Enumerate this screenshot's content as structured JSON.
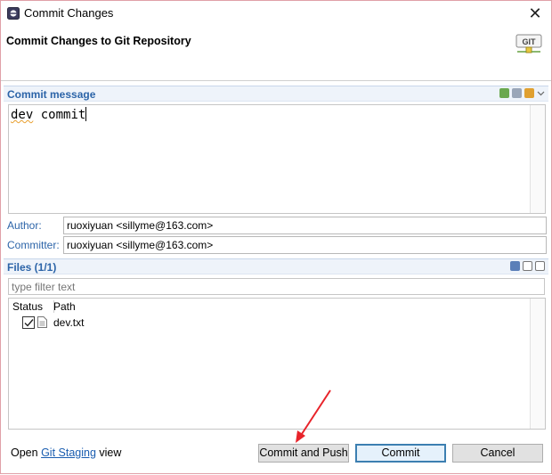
{
  "window": {
    "title": "Commit Changes",
    "close_glyph": "✕"
  },
  "header": {
    "title": "Commit Changes to Git Repository",
    "logo_text": "GIT"
  },
  "commit_message": {
    "section_title": "Commit message",
    "text_word1": "dev",
    "text_word2": "commit"
  },
  "author": {
    "label": "Author:",
    "value": "ruoxiyuan <sillyme@163.com>"
  },
  "committer": {
    "label": "Committer:",
    "value": "ruoxiyuan <sillyme@163.com>"
  },
  "files": {
    "section_title": "Files (1/1)",
    "filter_placeholder": "type filter text",
    "columns": [
      "Status",
      "Path"
    ],
    "rows": [
      {
        "path": "dev.txt",
        "checked": true
      }
    ]
  },
  "footer": {
    "open_text": "Open",
    "link_text": "Git Staging",
    "view_text": "view"
  },
  "buttons": {
    "commit_and_push": "Commit and Push",
    "commit": "Commit",
    "cancel": "Cancel"
  },
  "colors": {
    "section_title": "#2c64a8",
    "link": "#1a5db0",
    "default_button_border": "#3c7fb1",
    "annotation_arrow": "#e8232a"
  }
}
